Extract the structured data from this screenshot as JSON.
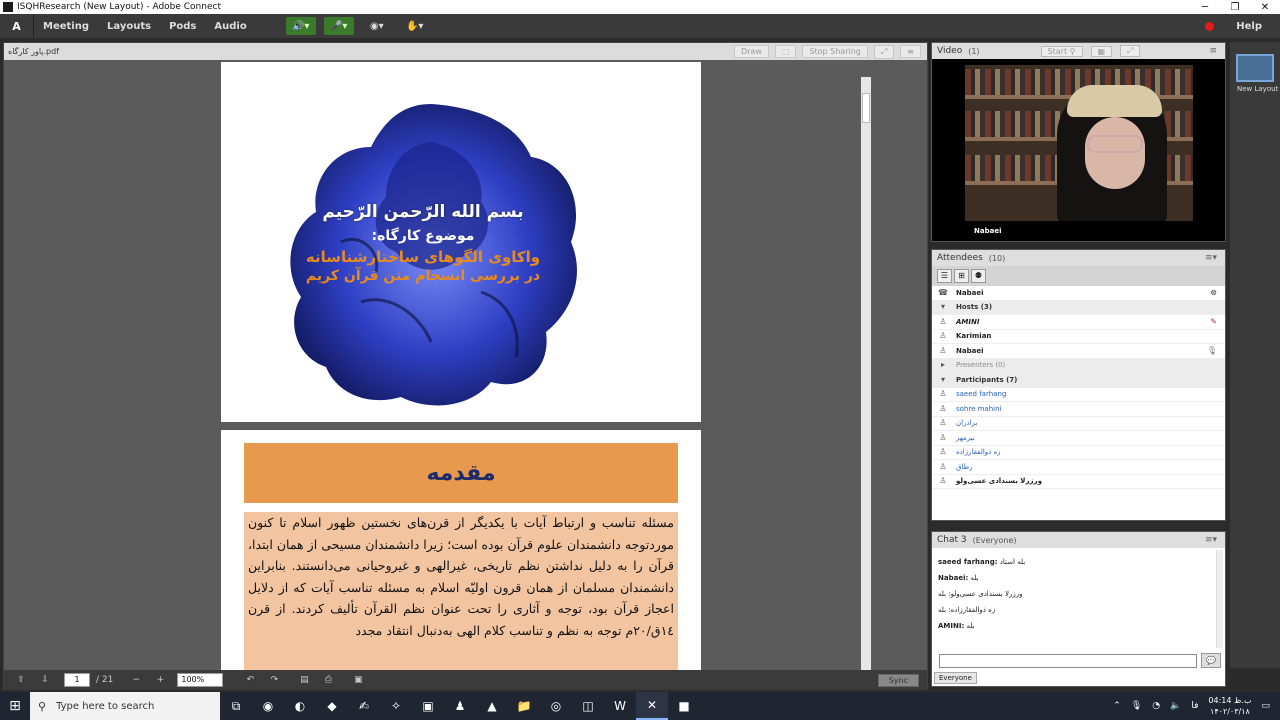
{
  "window": {
    "title": "ISQHResearch (New Layout) - Adobe Connect"
  },
  "menu": {
    "items": [
      "Meeting",
      "Layouts",
      "Pods",
      "Audio"
    ],
    "help": "Help",
    "logo": "Adobe"
  },
  "share": {
    "filename": "پاور کارگاه.pdf",
    "draw_label": "Draw",
    "stop_sharing": "Stop Sharing",
    "page_number": "1",
    "page_total": "/ 21",
    "zoom": "100%",
    "sync": "Sync",
    "slide1": {
      "line1": "بسم الله الرّحمن الرّحیم",
      "line2": "موضوع کارگاه:",
      "line3": "واکاوی الگوهای ساختارشناسانه",
      "line4": "در بررسی انسجام متن قرآن کریم"
    },
    "slide2": {
      "title": "مقدمه",
      "body": "مسئله تناسب و ارتباط آیات با یکدیگر از قرن‌های نخستین ظهور اسلام تا کنون موردتوجه دانشمندان علوم قرآن بوده است؛ زیرا دانشمندان مسیحی از همان ابتدا، قرآن را به دلیل نداشتن نظم تاریخی، غیرالهی و غیروحیانی می‌دانستند. بنابراین دانشمندان مسلمان از همان قرون اولیّه اسلام به مسئله تناسب آیات که از دلایل اعجاز قرآن بود، توجه و آثاری را تحت عنوان نظم القرآن تألیف کردند. از قرن ١٤ق/٢٠م توجه به نظم و تناسب کلام الهی به‌دنبال انتقاد مجدد"
    }
  },
  "video": {
    "title": "Video",
    "count": "(1)",
    "start": "Start",
    "name": "Nabaei"
  },
  "attendees": {
    "title": "Attendees",
    "count": "(10)",
    "selected": "Nabaei",
    "hosts_label": "Hosts (3)",
    "hosts": [
      "AMINI",
      "Karimian",
      "Nabaei"
    ],
    "presenters_label": "Presenters (0)",
    "participants_label": "Participants (7)",
    "participants": [
      "saeed farhang",
      "sohre mahini",
      "برادران",
      "نیرمهر",
      "زه ذوالفقارزاده",
      "رطاق",
      "ورزرلا بسندادی عسی‌ولو"
    ]
  },
  "chat": {
    "title": "Chat 3",
    "scope": "(Everyone)",
    "messages": [
      {
        "sender": "saeed farhang:",
        "text": "بله استاد"
      },
      {
        "sender": "Nabaei:",
        "text": "بله"
      },
      {
        "sender": "",
        "text": "ورزرلا بسندادی عسی‌ولو: بله"
      },
      {
        "sender": "",
        "text": "زه ذوالفقارزاده: بله"
      },
      {
        "sender": "AMINI:",
        "text": "بله"
      }
    ],
    "tab": "Everyone"
  },
  "layouts": {
    "label": "New Layout"
  },
  "taskbar": {
    "search_placeholder": "Type here to search",
    "time": "04:14 ب.ظ",
    "date": "۱۴۰۲/۰۳/۱۸",
    "lang": "فا"
  },
  "colors": {
    "menu_bg": "#3a3a3a",
    "slide_orange": "#e79a4e",
    "slide_body": "#f3c4a0",
    "title_blue": "#1d2b6b",
    "record_red": "#e31b1b"
  }
}
